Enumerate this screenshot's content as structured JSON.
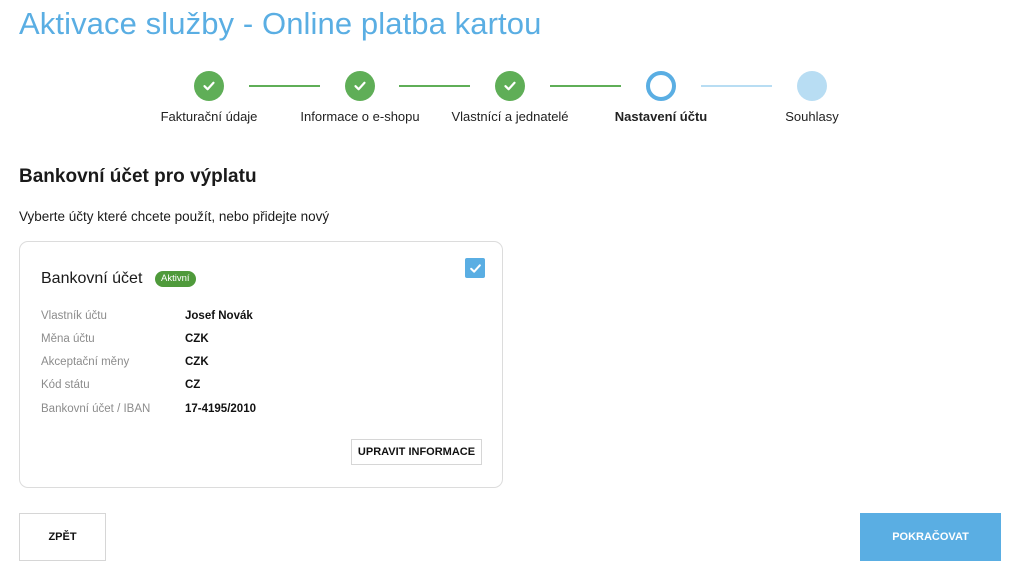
{
  "page": {
    "title": "Aktivace služby - Online platba kartou"
  },
  "stepper": {
    "steps": [
      {
        "label": "Fakturační údaje",
        "state": "done"
      },
      {
        "label": "Informace o e-shopu",
        "state": "done"
      },
      {
        "label": "Vlastnící a jednatelé",
        "state": "done"
      },
      {
        "label": "Nastavení účtu",
        "state": "current"
      },
      {
        "label": "Souhlasy",
        "state": "todo"
      }
    ]
  },
  "section": {
    "title": "Bankovní účet pro výplatu",
    "subtitle": "Vyberte účty které chcete použít, nebo přidejte nový"
  },
  "card": {
    "title": "Bankovní účet",
    "badge": "Aktivní",
    "checked": true,
    "rows": [
      {
        "label": "Vlastník účtu",
        "value": "Josef Novák"
      },
      {
        "label": "Měna účtu",
        "value": "CZK"
      },
      {
        "label": "Akceptační měny",
        "value": "CZK"
      },
      {
        "label": "Kód státu",
        "value": "CZ"
      },
      {
        "label": "Bankovní účet / IBAN",
        "value": "17-4195/2010"
      }
    ],
    "edit_label": "UPRAVIT INFORMACE"
  },
  "footer": {
    "back_label": "ZPĚT",
    "continue_label": "POKRAČOVAT"
  },
  "colors": {
    "accent": "#5aaee3",
    "done": "#5fae57",
    "todo": "#b8ddf3",
    "badge": "#4f9a3b"
  },
  "icons": {
    "step_done": "check-icon",
    "checkbox": "check-icon"
  }
}
